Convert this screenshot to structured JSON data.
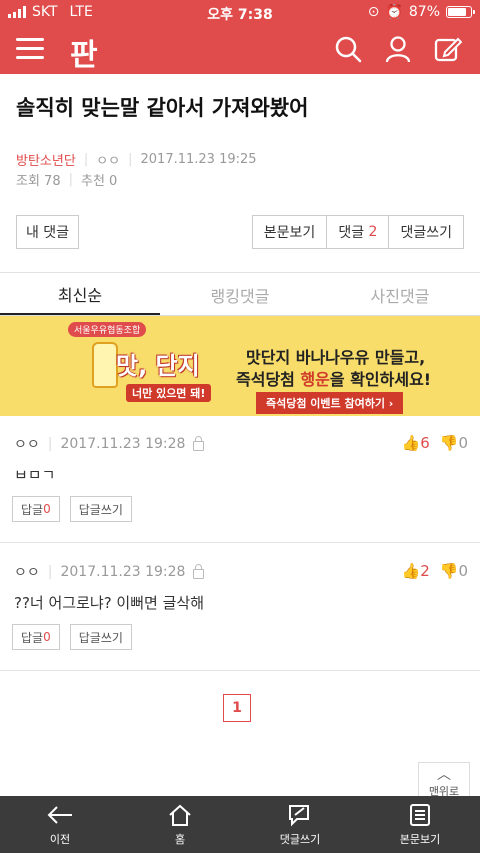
{
  "status_bar": {
    "carrier": "SKT",
    "network": "LTE",
    "time": "오후 7:38",
    "battery": "87%",
    "battery_level": 0.87
  },
  "app_bar": {
    "logo": "판",
    "icons": [
      "menu-icon",
      "search-icon",
      "user-icon",
      "write-icon"
    ]
  },
  "post": {
    "title": "솔직히 맞는말 같아서 가져와봤어",
    "category": "방탄소년단",
    "author": "ㅇㅇ",
    "date": "2017.11.23 19:25",
    "views_label": "조회 78",
    "recommend_label": "추천 0"
  },
  "actions": {
    "my_comments": "내 댓글",
    "view_post": "본문보기",
    "comments_label": "댓글",
    "comments_count": "2",
    "write_comment": "댓글쓰기"
  },
  "tabs": [
    {
      "label": "최신순",
      "active": true
    },
    {
      "label": "랭킹댓글",
      "active": false
    },
    {
      "label": "사진댓글",
      "active": false
    }
  ],
  "banner": {
    "badge": "서울우유협동조합",
    "big": "맛, 단지",
    "small": "너만 있으면 돼!",
    "line1_a": "맛단지 ",
    "line1_b": "바나나우유 만들고,",
    "line2_a": "즉석당첨 ",
    "line2_b": "행운",
    "line2_c": "을 확인하세요!",
    "cta": "즉석당첨 이벤트 참여하기 ›"
  },
  "comments": [
    {
      "author": "ㅇㅇ",
      "date": "2017.11.23 19:28",
      "text": "ㅂㅁㄱ",
      "likes": "6",
      "dislikes": "0",
      "reply_label": "답글",
      "reply_count": "0",
      "write_reply": "답글쓰기"
    },
    {
      "author": "ㅇㅇ",
      "date": "2017.11.23 19:28",
      "text": "??너 어그로냐? 이뻐면 글삭해",
      "likes": "2",
      "dislikes": "0",
      "reply_label": "답글",
      "reply_count": "0",
      "write_reply": "답글쓰기"
    }
  ],
  "pagination": {
    "current": "1"
  },
  "to_top": "맨위로",
  "bottom_nav": [
    {
      "label": "이전",
      "icon": "back-arrow-icon"
    },
    {
      "label": "홈",
      "icon": "home-icon"
    },
    {
      "label": "댓글쓰기",
      "icon": "comment-write-icon"
    },
    {
      "label": "본문보기",
      "icon": "document-icon"
    }
  ],
  "colors": {
    "brand": "#e04c4c",
    "banner_bg": "#f8dd6a",
    "bottom_bar": "#3b3b3b"
  }
}
